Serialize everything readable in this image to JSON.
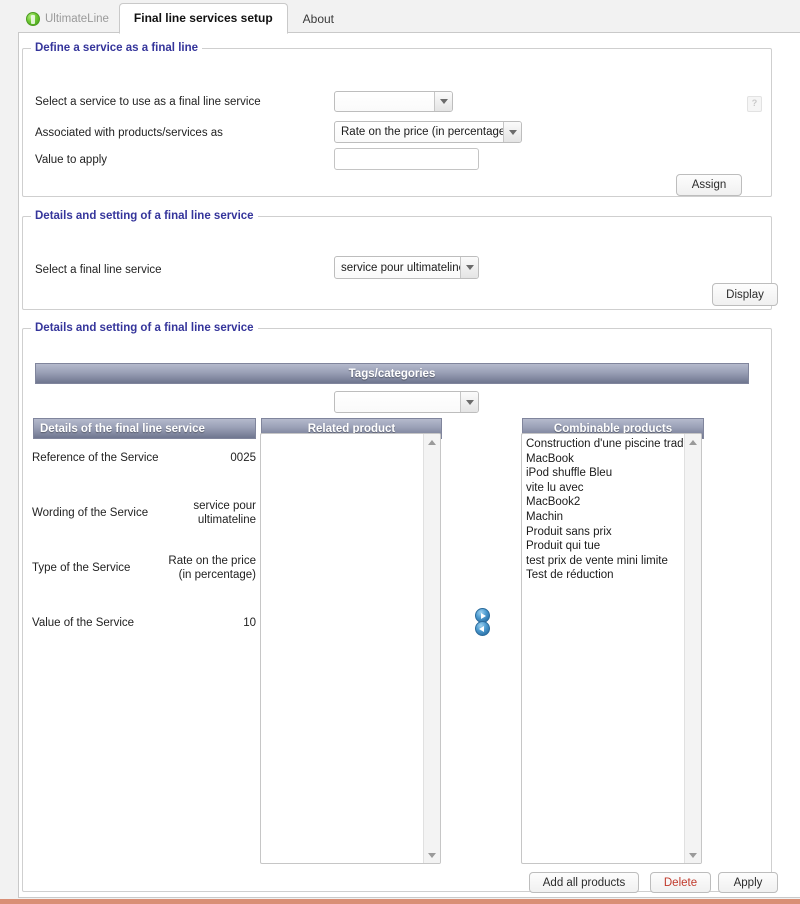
{
  "tabstrip": {
    "brand": "UltimateLine",
    "brand_icon": "ultimateline-logo-icon",
    "tabs": [
      {
        "label": "Final line services setup",
        "active": true
      },
      {
        "label": "About",
        "active": false
      }
    ]
  },
  "section_define": {
    "legend": "Define a service as a final line",
    "service_label": "Select a service to use as a final line service",
    "service_value": "",
    "association_label": "Associated with products/services as",
    "association_value": "Rate on the price (in percentage)",
    "value_label": "Value to apply",
    "value_input": "",
    "value_placeholder": "",
    "assign_button": "Assign",
    "help_icon": "?"
  },
  "section_select": {
    "legend": "Details and setting of a final line service",
    "service_label": "Select a final line service",
    "service_value": "service pour ultimateline",
    "display_button": "Display"
  },
  "section_details": {
    "legend": "Details and setting of a final line service",
    "tags_header": "Tags/categories",
    "tags_value": "",
    "columns": {
      "details": "Details of the final line service",
      "related": "Related product",
      "combinable": "Combinable products"
    },
    "detail_rows": [
      {
        "key": "Reference of the Service",
        "value": "0025"
      },
      {
        "key": "Wording of the Service",
        "value": "service pour ultimateline"
      },
      {
        "key": "Type of the Service",
        "value": "Rate on the price (in percentage)"
      },
      {
        "key": "Value of the Service",
        "value": "10"
      }
    ],
    "related_products": [],
    "combinable_products": [
      "Construction d'une piscine traditio",
      "MacBook",
      "iPod shuffle Bleu",
      "vite lu avec",
      "MacBook2",
      "Machin",
      "Produit sans prix",
      "Produit qui tue",
      "test prix de vente mini limite",
      "Test de réduction"
    ],
    "transfer_right_icon": "arrow-right-circle-icon",
    "transfer_left_icon": "arrow-left-circle-icon",
    "buttons": {
      "add_all": "Add all products",
      "delete": "Delete",
      "apply": "Apply"
    }
  },
  "colors": {
    "legend": "#35359b",
    "header_bar": "#7b819a",
    "danger": "#c0392b",
    "accent_bottom": "#d98f76"
  }
}
